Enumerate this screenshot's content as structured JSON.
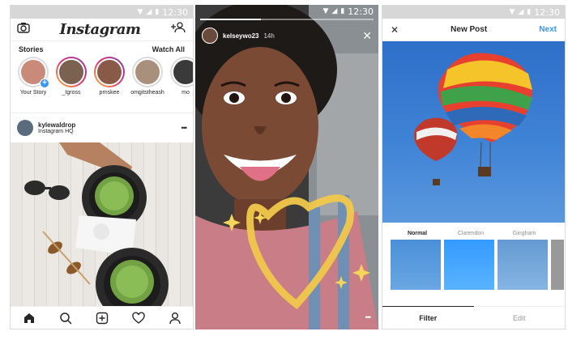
{
  "status_time": "12:30",
  "feed": {
    "logo": "Instagram",
    "stories_label": "Stories",
    "watch_all": "Watch All",
    "stories": [
      {
        "name": "Your Story",
        "ring": false,
        "color": "#c98a7a"
      },
      {
        "name": "_tgross",
        "ring": true,
        "color": "#7a6150"
      },
      {
        "name": "prnskee",
        "ring": true,
        "color": "#8a5a48"
      },
      {
        "name": "omgitstheash",
        "ring": false,
        "color": "#a9907d"
      },
      {
        "name": "mo",
        "ring": false,
        "color": "#3a3a3a"
      }
    ],
    "post": {
      "user": "kylewaldrop",
      "location": "Instagram HQ",
      "more": "•••"
    },
    "tabs": [
      "home-icon",
      "search-icon",
      "add-icon",
      "heart-icon",
      "profile-icon"
    ]
  },
  "story": {
    "user": "kelseywo23",
    "time": "14h",
    "progress": 0.35
  },
  "new_post": {
    "close": "✕",
    "title": "New Post",
    "next": "Next",
    "filters": [
      {
        "name": "Normal",
        "selected": true
      },
      {
        "name": "Clarendon",
        "selected": false
      },
      {
        "name": "Gingham",
        "selected": false
      }
    ],
    "tabs": [
      {
        "label": "Filter",
        "active": true
      },
      {
        "label": "Edit",
        "active": false
      }
    ]
  }
}
